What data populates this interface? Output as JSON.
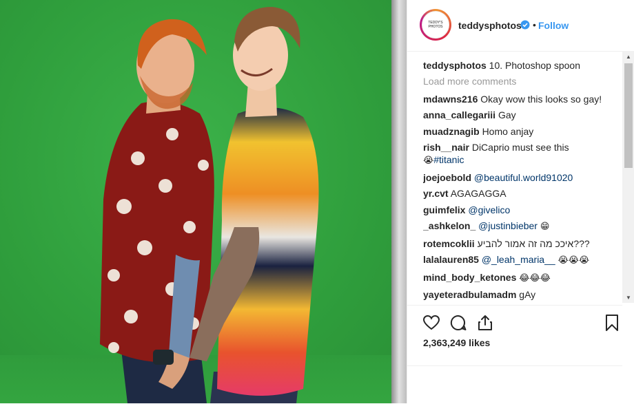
{
  "post": {
    "username": "teddysphotos",
    "avatar_text": "TEDDY'S PHOTOS",
    "separator": "•",
    "follow_label": "Follow",
    "caption": {
      "user": "teddysphotos",
      "text": "10. Photoshop spoon"
    },
    "load_more": "Load more comments",
    "likes": "2,363,249 likes"
  },
  "comments": [
    {
      "user": "mdawns216",
      "text": "Okay wow this looks so gay!"
    },
    {
      "user": "anna_callegariii",
      "text": "Gay"
    },
    {
      "user": "muadznagib",
      "text": "Homo anjay"
    },
    {
      "user": "rish__nair",
      "text": "DiCaprio must see this",
      "emoji": "😭",
      "mention": "#titanic"
    },
    {
      "user": "joejoebold",
      "mention": "@beautiful.world91020"
    },
    {
      "user": "yr.cvt",
      "text": "AGAGAGGA"
    },
    {
      "user": "guimfelix",
      "mention": "@givelico"
    },
    {
      "user": "_ashkelon_",
      "mention": "@justinbieber",
      "emoji": "😁"
    },
    {
      "user": "rotemcoklii",
      "text": "איככ מה זה אמור להביע???"
    },
    {
      "user": "lalalauren85",
      "mention": "@_leah_maria__",
      "emoji": "😭😭😭"
    },
    {
      "user": "mind_body_ketones",
      "emoji": "😂😂😂"
    },
    {
      "user": "yayeteradbulamadm",
      "text": "gAy"
    }
  ],
  "icons": {
    "verified": "verified-badge-icon",
    "like": "heart-icon",
    "comment": "comment-bubble-icon",
    "share": "share-icon",
    "save": "bookmark-icon"
  },
  "colors": {
    "link": "#3897f0",
    "mention": "#003569",
    "greenscreen": "#34a540"
  }
}
